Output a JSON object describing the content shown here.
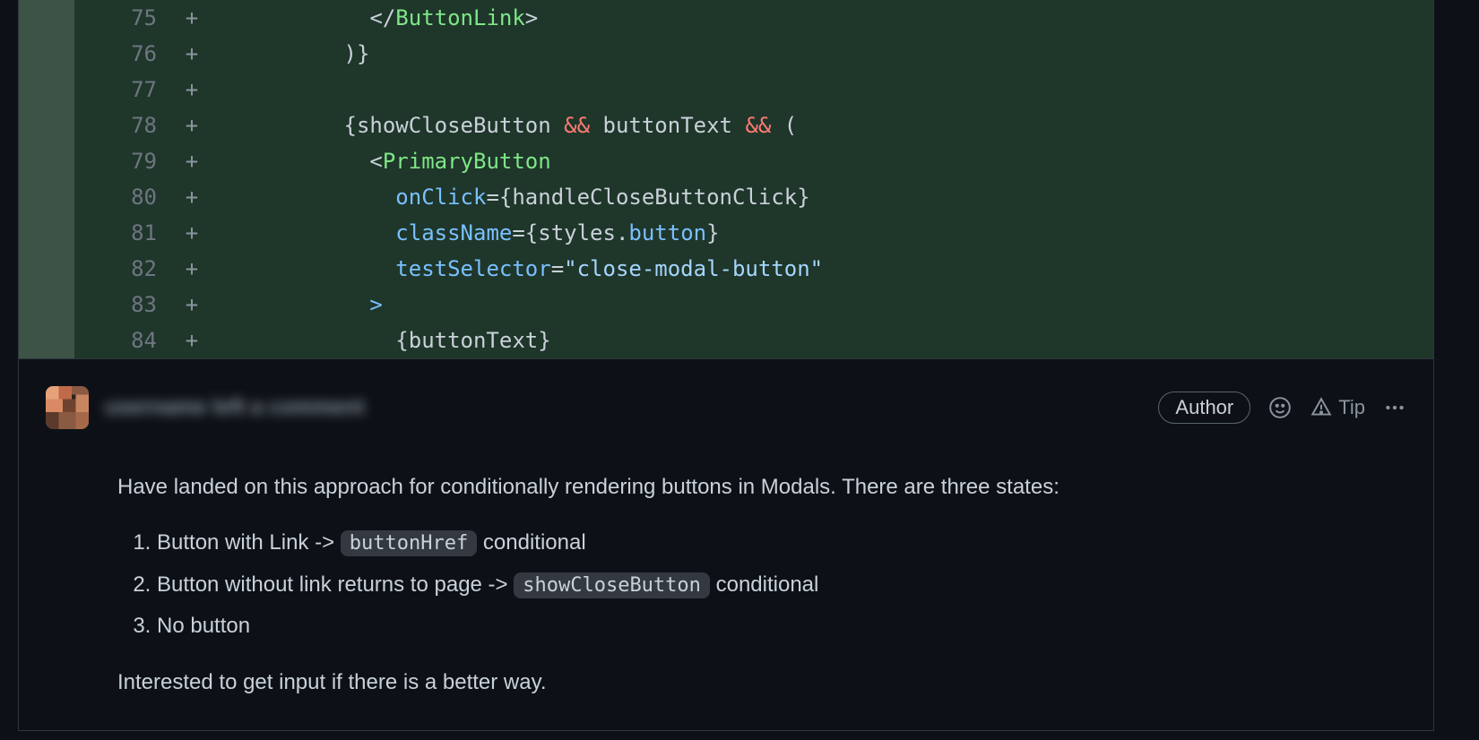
{
  "diff": {
    "lines": [
      {
        "num": 75,
        "marker": "+",
        "html": "            &lt;/<span class='t-tag'>ButtonLink</span>&gt;"
      },
      {
        "num": 76,
        "marker": "+",
        "html": "          )}"
      },
      {
        "num": 77,
        "marker": "+",
        "html": ""
      },
      {
        "num": 78,
        "marker": "+",
        "html": "          {showCloseButton <span class='t-key'>&amp;&amp;</span> buttonText <span class='t-key'>&amp;&amp;</span> ("
      },
      {
        "num": 79,
        "marker": "+",
        "html": "            &lt;<span class='t-tag'>PrimaryButton</span>"
      },
      {
        "num": 80,
        "marker": "+",
        "html": "              <span class='t-attr'>onClick</span>={handleCloseButtonClick}"
      },
      {
        "num": 81,
        "marker": "+",
        "html": "              <span class='t-attr'>className</span>={styles.<span class='t-attr'>button</span>}"
      },
      {
        "num": 82,
        "marker": "+",
        "html": "              <span class='t-attr'>testSelector</span>=<span class='t-str'>\"close-modal-button\"</span>"
      },
      {
        "num": 83,
        "marker": "+",
        "html": "            <span class='t-attr'>&gt;</span>"
      },
      {
        "num": 84,
        "marker": "+",
        "html": "              {buttonText}"
      }
    ]
  },
  "comment": {
    "header": {
      "author_badge": "Author",
      "tip_label": "Tip",
      "blurred_text": "username  left a comment"
    },
    "body": {
      "intro": "Have landed on this approach for conditionally rendering buttons in Modals. There are three states:",
      "items": [
        {
          "before": "Button with Link -> ",
          "code": "buttonHref",
          "after": " conditional"
        },
        {
          "before": "Button without link returns to page -> ",
          "code": "showCloseButton",
          "after": " conditional"
        },
        {
          "before": "No button",
          "code": "",
          "after": ""
        }
      ],
      "outro": "Interested to get input if there is a better way."
    }
  }
}
